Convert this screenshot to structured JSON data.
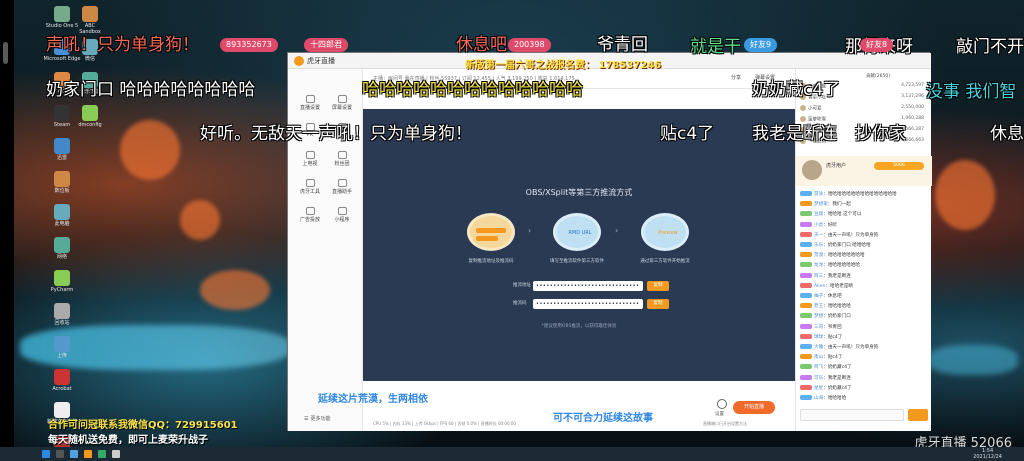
{
  "desktop": {
    "icons_col1": [
      "Studio One 5",
      "Microsoft Edge",
      "QQ",
      "Steam",
      "迅雷",
      "数位板",
      "此电脑",
      "网络",
      "PyCharm",
      "回收站",
      "上传",
      "Acrobat",
      "新建文本文档",
      "AVerMedia"
    ],
    "icons_col2": [
      "ABC Sandbox",
      "微信",
      "音乐下载",
      "dmconfig"
    ]
  },
  "danmaku": {
    "row1": [
      "声吼！只为单身狗！",
      "休息吧",
      "爷青回",
      "就是干",
      "那得来呀",
      "敲门不开"
    ],
    "row2": [
      "奶家门口 哈哈哈哈哈哈哈哈",
      "哈哈哈哈哈哈哈哈哈哈哈哈哈",
      "奶奶藏c4了",
      "没事 我们智"
    ],
    "row3": [
      "好听。无敌天一声吼！只为单身狗！",
      "贴c4了",
      "我老是断连",
      "抄你家",
      "休息"
    ],
    "badges": [
      "893352673",
      "十四郎君",
      "200398",
      "好友9",
      "好友8"
    ]
  },
  "overlays": {
    "top_banner": "新版第一届六哥之战报名费： 178537246",
    "bottom_left_1": "延续这片荒漠，生两相依",
    "bottom_left_2": "合作可问冠联系我微信QQ：729915601",
    "bottom_left_3": "每天随机送免费，即可上麦荣升战子",
    "bottom_center": "可不可合力延续这故事",
    "watermark": "虎牙直播 52066"
  },
  "app": {
    "logo_text": "虎牙直播",
    "room_header": "主播：房间号 我在直播 | 粉丝 55937 | 订阅 12,455 | 人气 3,199,250 | 收益 1,014,175",
    "header_right": [
      "分享",
      "弹幕设置"
    ],
    "nav": [
      {
        "label": "直播设置"
      },
      {
        "label": "屏幕设置"
      },
      {
        "label": "PK"
      },
      {
        "label": "连麦"
      },
      {
        "label": "上电视"
      },
      {
        "label": "粉丝团"
      },
      {
        "label": "虎牙工具"
      },
      {
        "label": "直播助手"
      },
      {
        "label": "广告投放"
      },
      {
        "label": "小程序"
      }
    ],
    "settings_label": "更多功能",
    "panel": {
      "title": "OBS/XSplit等第三方推流方式",
      "step1_label": "",
      "step2_label": "RMD URL",
      "step3_label": "Preview",
      "step1_caption": "复制推流地址及推流码",
      "step2_caption": "填写至推流软件第三方软件",
      "step3_caption": "通过第三方软件开始推流",
      "field1_label": "推流地址",
      "field1_value": "••••••••••••••••••••••••••••••",
      "field2_label": "推流码",
      "field2_value": "••••••••••••••••••••••••••••••",
      "copy_label": "复制",
      "hint": "*建议使用OBS推流，以获得最佳体验"
    },
    "bottom": {
      "start_label": "开始直播",
      "settings_label": "设置",
      "tool_row": "CPU 5% | 内存 33% | 上传 0kbps | FPS 60 | 丢帧 0.0% | 直播时长 00:00:00",
      "right_tool": "直播端口已开启设置方法"
    }
  },
  "sidebar": {
    "ranking_title": "贡献(2650)",
    "ranks": [
      {
        "name": "天蝎贵族",
        "value": "4,723,597"
      },
      {
        "name": "香菜不吃",
        "value": "3,137,296"
      },
      {
        "name": "小可爱",
        "value": "2,550,000"
      },
      {
        "name": "菠萝吹雪",
        "value": "1,060,288"
      },
      {
        "name": "梦想家",
        "value": "5,566,287"
      },
      {
        "name": "一夜之间",
        "value": "3,666,663"
      }
    ],
    "gift": {
      "name": "虎牙用户",
      "gold": "5066"
    },
    "chat": [
      {
        "user": "游泳",
        "text": "哈哈哈哈哈哈哈哈哈哈哈哈哈哈哈"
      },
      {
        "user": "梦想家",
        "text": "我们一起"
      },
      {
        "user": "豆腐",
        "text": "哈哈哈 这个可以"
      },
      {
        "user": "小虎",
        "text": "好听"
      },
      {
        "user": "天一",
        "text": "由天一声吼！只为单身狗"
      },
      {
        "user": "乐乐",
        "text": "奶奶家门口 哈哈哈哈"
      },
      {
        "user": "荒漠",
        "text": "哈哈哈哈哈哈哈哈"
      },
      {
        "user": "龙龙",
        "text": "哈哈哈哈哈哈哈"
      },
      {
        "user": "阿三",
        "text": "我老是断连"
      },
      {
        "user": "Alien",
        "text": "哈哈老是断"
      },
      {
        "user": "柚子",
        "text": "休息吧"
      },
      {
        "user": "老王",
        "text": "哈哈哈哈哈"
      },
      {
        "user": "梦想",
        "text": "奶奶家门口"
      },
      {
        "user": "三哥",
        "text": "爷青回"
      },
      {
        "user": "球球",
        "text": "贴c4了"
      },
      {
        "user": "大锤",
        "text": "由天一声吼！只为单身狗"
      },
      {
        "user": "南山",
        "text": "贴c4了"
      },
      {
        "user": "阿飞",
        "text": "奶奶藏c4了"
      },
      {
        "user": "可乐",
        "text": "我老是断连"
      },
      {
        "user": "星星",
        "text": "奶奶藏c4了"
      },
      {
        "user": "山海",
        "text": "哈哈哈哈"
      }
    ]
  },
  "taskbar": {
    "time": "1:54",
    "date": "2021/12/24"
  }
}
